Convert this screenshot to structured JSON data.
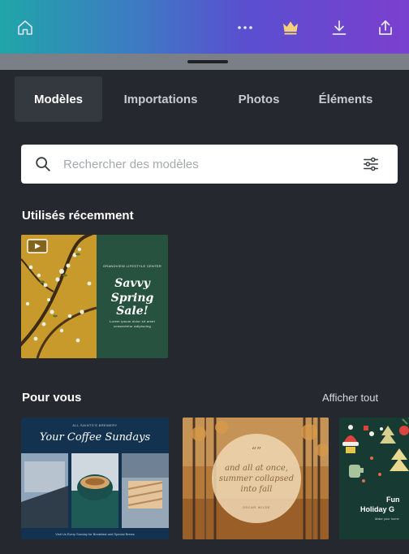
{
  "toolbar": {
    "icons": [
      "home-icon",
      "more-icon",
      "crown-icon",
      "download-icon",
      "share-icon"
    ],
    "gradient": [
      "#1fa6a9",
      "#3f78c4",
      "#5a4fd0",
      "#7b3fce"
    ]
  },
  "tabs": [
    {
      "label": "Modèles",
      "active": true
    },
    {
      "label": "Importations",
      "active": false
    },
    {
      "label": "Photos",
      "active": false
    },
    {
      "label": "Éléments",
      "active": false
    }
  ],
  "search": {
    "placeholder": "Rechercher des modèles",
    "value": ""
  },
  "recent": {
    "title": "Utilisés récemment",
    "card": {
      "kicker": "GRANDVIEW LIFESTYLE CENTER",
      "headline_1": "Savvy",
      "headline_2": "Spring Sale!",
      "fineprint": "Lorem ipsum dolor sit amet consectetur adipiscing",
      "has_video_badge": true
    }
  },
  "for_you": {
    "title": "Pour vous",
    "see_all": "Afficher tout",
    "cards": [
      {
        "kicker": "ALL SAINTS'S BREWERY",
        "title": "Your Coffee Sundays",
        "footer": "Visit Us Every Sunday for Breakfast and Special Brews"
      },
      {
        "quote_mark": "“”",
        "quote": "and all at once, summer collapsed into fall",
        "author": "OSCAR WILDE"
      },
      {
        "line1": "Fun",
        "line2": "Holiday G",
        "sub": "Make your home"
      }
    ]
  },
  "colors": {
    "background": "#25292f",
    "tab_active": "#34383f",
    "handle_strip": "#7a7f88"
  }
}
